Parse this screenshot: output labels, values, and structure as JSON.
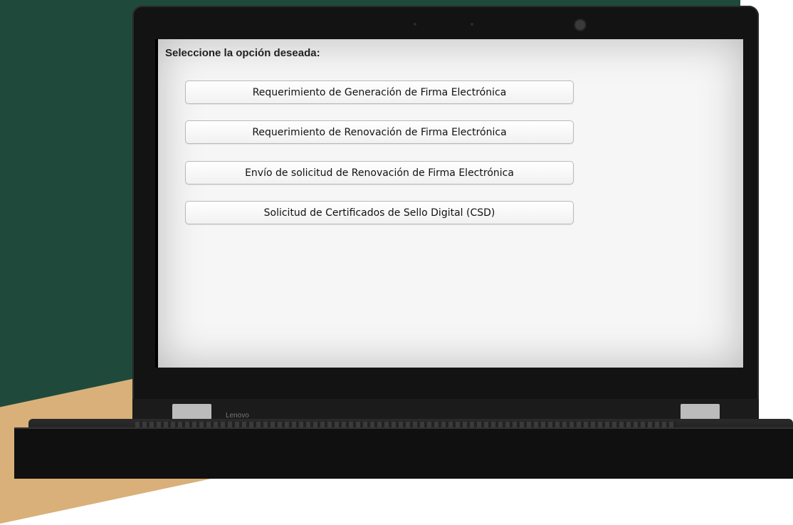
{
  "page": {
    "prompt": "Seleccione la opción deseada:",
    "options": [
      {
        "label": "Requerimiento de Generación de Firma Electrónica"
      },
      {
        "label": "Requerimiento de Renovación de Firma Electrónica"
      },
      {
        "label": "Envío de solicitud de Renovación de Firma Electrónica"
      },
      {
        "label": "Solicitud de Certificados de Sello Digital (CSD)"
      }
    ]
  },
  "device": {
    "brand": "Lenovo"
  },
  "colors": {
    "background": "#1f4a3b",
    "accent_stripe": "#d9b07a",
    "bezel": "#131313",
    "screen": "#f6f6f6"
  }
}
